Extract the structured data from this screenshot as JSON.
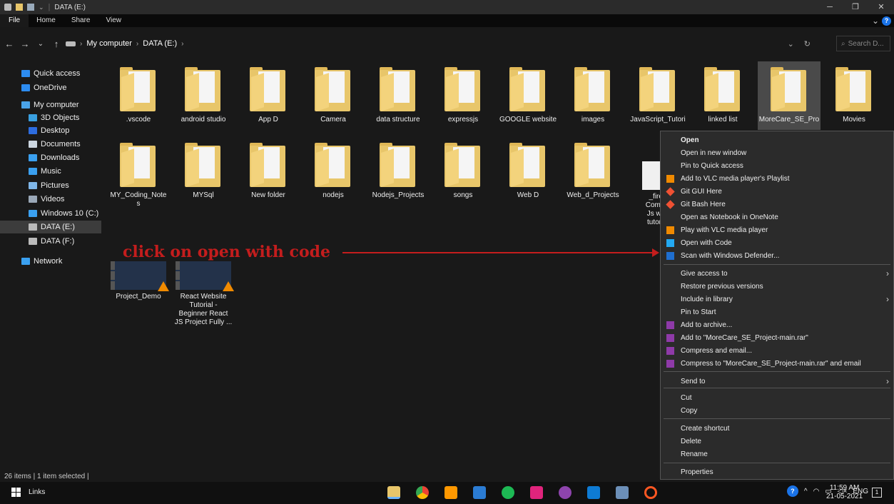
{
  "window": {
    "title": "DATA (E:)",
    "minimize": "─",
    "maximize": "❐",
    "close": "✕"
  },
  "ribbon": {
    "tabs": [
      "File",
      "Home",
      "Share",
      "View"
    ],
    "expand": "⌄",
    "help": "?"
  },
  "nav": {
    "back": "←",
    "forward": "→",
    "recent": "⌄",
    "up": "↑",
    "breadcrumb": [
      "My computer",
      "DATA (E:)"
    ],
    "dropdown": "⌄",
    "refresh": "↻",
    "search_placeholder": "Search D..."
  },
  "sidebar": [
    {
      "label": "Quick access",
      "icon": "star-icon",
      "color": "#2d8cf0"
    },
    {
      "label": "OneDrive",
      "icon": "cloud-icon",
      "color": "#2d8cf0"
    },
    {
      "label": "My computer",
      "icon": "computer-icon",
      "color": "#4aa3e8"
    },
    {
      "label": "3D Objects",
      "icon": "cube-icon",
      "color": "#39a0e0"
    },
    {
      "label": "Desktop",
      "icon": "desktop-icon",
      "color": "#2d6cdf"
    },
    {
      "label": "Documents",
      "icon": "document-icon",
      "color": "#ccd6e0"
    },
    {
      "label": "Downloads",
      "icon": "download-icon",
      "color": "#3aa0f0"
    },
    {
      "label": "Music",
      "icon": "music-icon",
      "color": "#3aa0f0"
    },
    {
      "label": "Pictures",
      "icon": "picture-icon",
      "color": "#7fb6e8"
    },
    {
      "label": "Videos",
      "icon": "video-icon",
      "color": "#9aa8b8"
    },
    {
      "label": "Windows 10 (C:)",
      "icon": "drive-icon",
      "color": "#3aa0f0"
    },
    {
      "label": "DATA (E:)",
      "icon": "drive-icon",
      "color": "#bbbbbb"
    },
    {
      "label": "DATA (F:)",
      "icon": "drive-icon",
      "color": "#bbbbbb"
    },
    {
      "label": "Network",
      "icon": "network-icon",
      "color": "#3aa0f0"
    }
  ],
  "items": [
    {
      "label": ".vscode",
      "kind": "folder"
    },
    {
      "label": "android studio",
      "kind": "folder"
    },
    {
      "label": "App D",
      "kind": "folder"
    },
    {
      "label": "Camera",
      "kind": "folder"
    },
    {
      "label": "data structure",
      "kind": "folder"
    },
    {
      "label": "expressjs",
      "kind": "folder"
    },
    {
      "label": "GOOGLE website",
      "kind": "folder"
    },
    {
      "label": "images",
      "kind": "folder"
    },
    {
      "label": "JavaScript_Tutori",
      "kind": "folder"
    },
    {
      "label": "linked list",
      "kind": "folder"
    },
    {
      "label": "MoreCare_SE_Pro",
      "kind": "folder"
    },
    {
      "label": "Movies",
      "kind": "folder"
    },
    {
      "label": "MY_Coding_Note",
      "label2": "s",
      "kind": "folder"
    },
    {
      "label": "MYSql",
      "kind": "folder"
    },
    {
      "label": "New folder",
      "kind": "folder"
    },
    {
      "label": "nodejs",
      "kind": "folder"
    },
    {
      "label": "Nodejs_Projects",
      "kind": "folder"
    },
    {
      "label": "songs",
      "kind": "folder"
    },
    {
      "label": "Web D",
      "kind": "folder"
    },
    {
      "label": "Web_d_Projects",
      "kind": "folder"
    },
    {
      "label": "_fire_",
      "label2": "Comple",
      "label3": "Js with",
      "label4": "tutorial",
      "kind": "file"
    },
    {
      "label": "Project_Demo",
      "kind": "video"
    },
    {
      "label": "React Website",
      "label2": "Tutorial -",
      "label3": "Beginner React",
      "label4": "JS Project Fully ...",
      "kind": "video"
    }
  ],
  "annotation": {
    "text": "click on open with code"
  },
  "context_menu": [
    {
      "label": "Open",
      "bold": true
    },
    {
      "label": "Open in new window"
    },
    {
      "label": "Pin to Quick access"
    },
    {
      "label": "Add to VLC media player's Playlist",
      "icon": "vlc-icon"
    },
    {
      "label": "Git GUI Here",
      "icon": "git-icon"
    },
    {
      "label": "Git Bash Here",
      "icon": "git-icon"
    },
    {
      "label": "Open as Notebook in OneNote"
    },
    {
      "label": "Play with VLC media player",
      "icon": "vlc-icon"
    },
    {
      "label": "Open with Code",
      "icon": "vscode-icon"
    },
    {
      "label": "Scan with Windows Defender...",
      "icon": "defender-icon"
    },
    {
      "label": "Give access to",
      "submenu": true
    },
    {
      "label": "Restore previous versions"
    },
    {
      "label": "Include in library",
      "submenu": true
    },
    {
      "label": "Pin to Start"
    },
    {
      "label": "Add to archive...",
      "icon": "winrar-icon"
    },
    {
      "label": "Add to \"MoreCare_SE_Project-main.rar\"",
      "icon": "winrar-icon"
    },
    {
      "label": "Compress and email...",
      "icon": "winrar-icon"
    },
    {
      "label": "Compress to \"MoreCare_SE_Project-main.rar\" and email",
      "icon": "winrar-icon"
    },
    {
      "label": "Send to",
      "submenu": true
    },
    {
      "label": "Cut"
    },
    {
      "label": "Copy"
    },
    {
      "label": "Create shortcut"
    },
    {
      "label": "Delete"
    },
    {
      "label": "Rename"
    },
    {
      "label": "Properties"
    }
  ],
  "status": {
    "text": "26 items  |  1 item selected  |"
  },
  "taskbar": {
    "links": "Links",
    "time": "11:59 AM",
    "date": "21-05-2021",
    "lang": "ENG",
    "notif_count": "1"
  }
}
